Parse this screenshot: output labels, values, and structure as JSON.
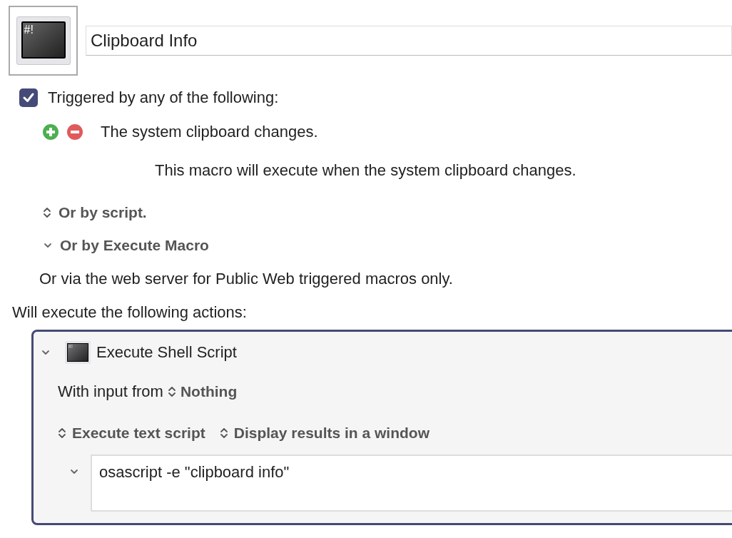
{
  "macro": {
    "icon_glyph": "#!",
    "name": "Clipboard Info"
  },
  "triggers": {
    "enabled": true,
    "label": "Triggered by any of the following:",
    "items": [
      {
        "text": "The system clipboard changes.",
        "description": "This macro will execute when the system clipboard changes."
      }
    ],
    "options": [
      {
        "kind": "popup",
        "label": "Or by script."
      },
      {
        "kind": "disclosure",
        "expanded": true,
        "label": "Or by Execute Macro"
      }
    ],
    "web_note": "Or via the web server for Public Web triggered macros only."
  },
  "actions_label": "Will execute the following actions:",
  "actions": [
    {
      "expanded": true,
      "icon_glyph": "#!",
      "title": "Execute Shell Script",
      "input_label": "With input from",
      "input_value": "Nothing",
      "popups": [
        "Execute text script",
        "Display results in a window"
      ],
      "script_expanded": true,
      "script": "osascript -e \"clipboard info\""
    }
  ]
}
